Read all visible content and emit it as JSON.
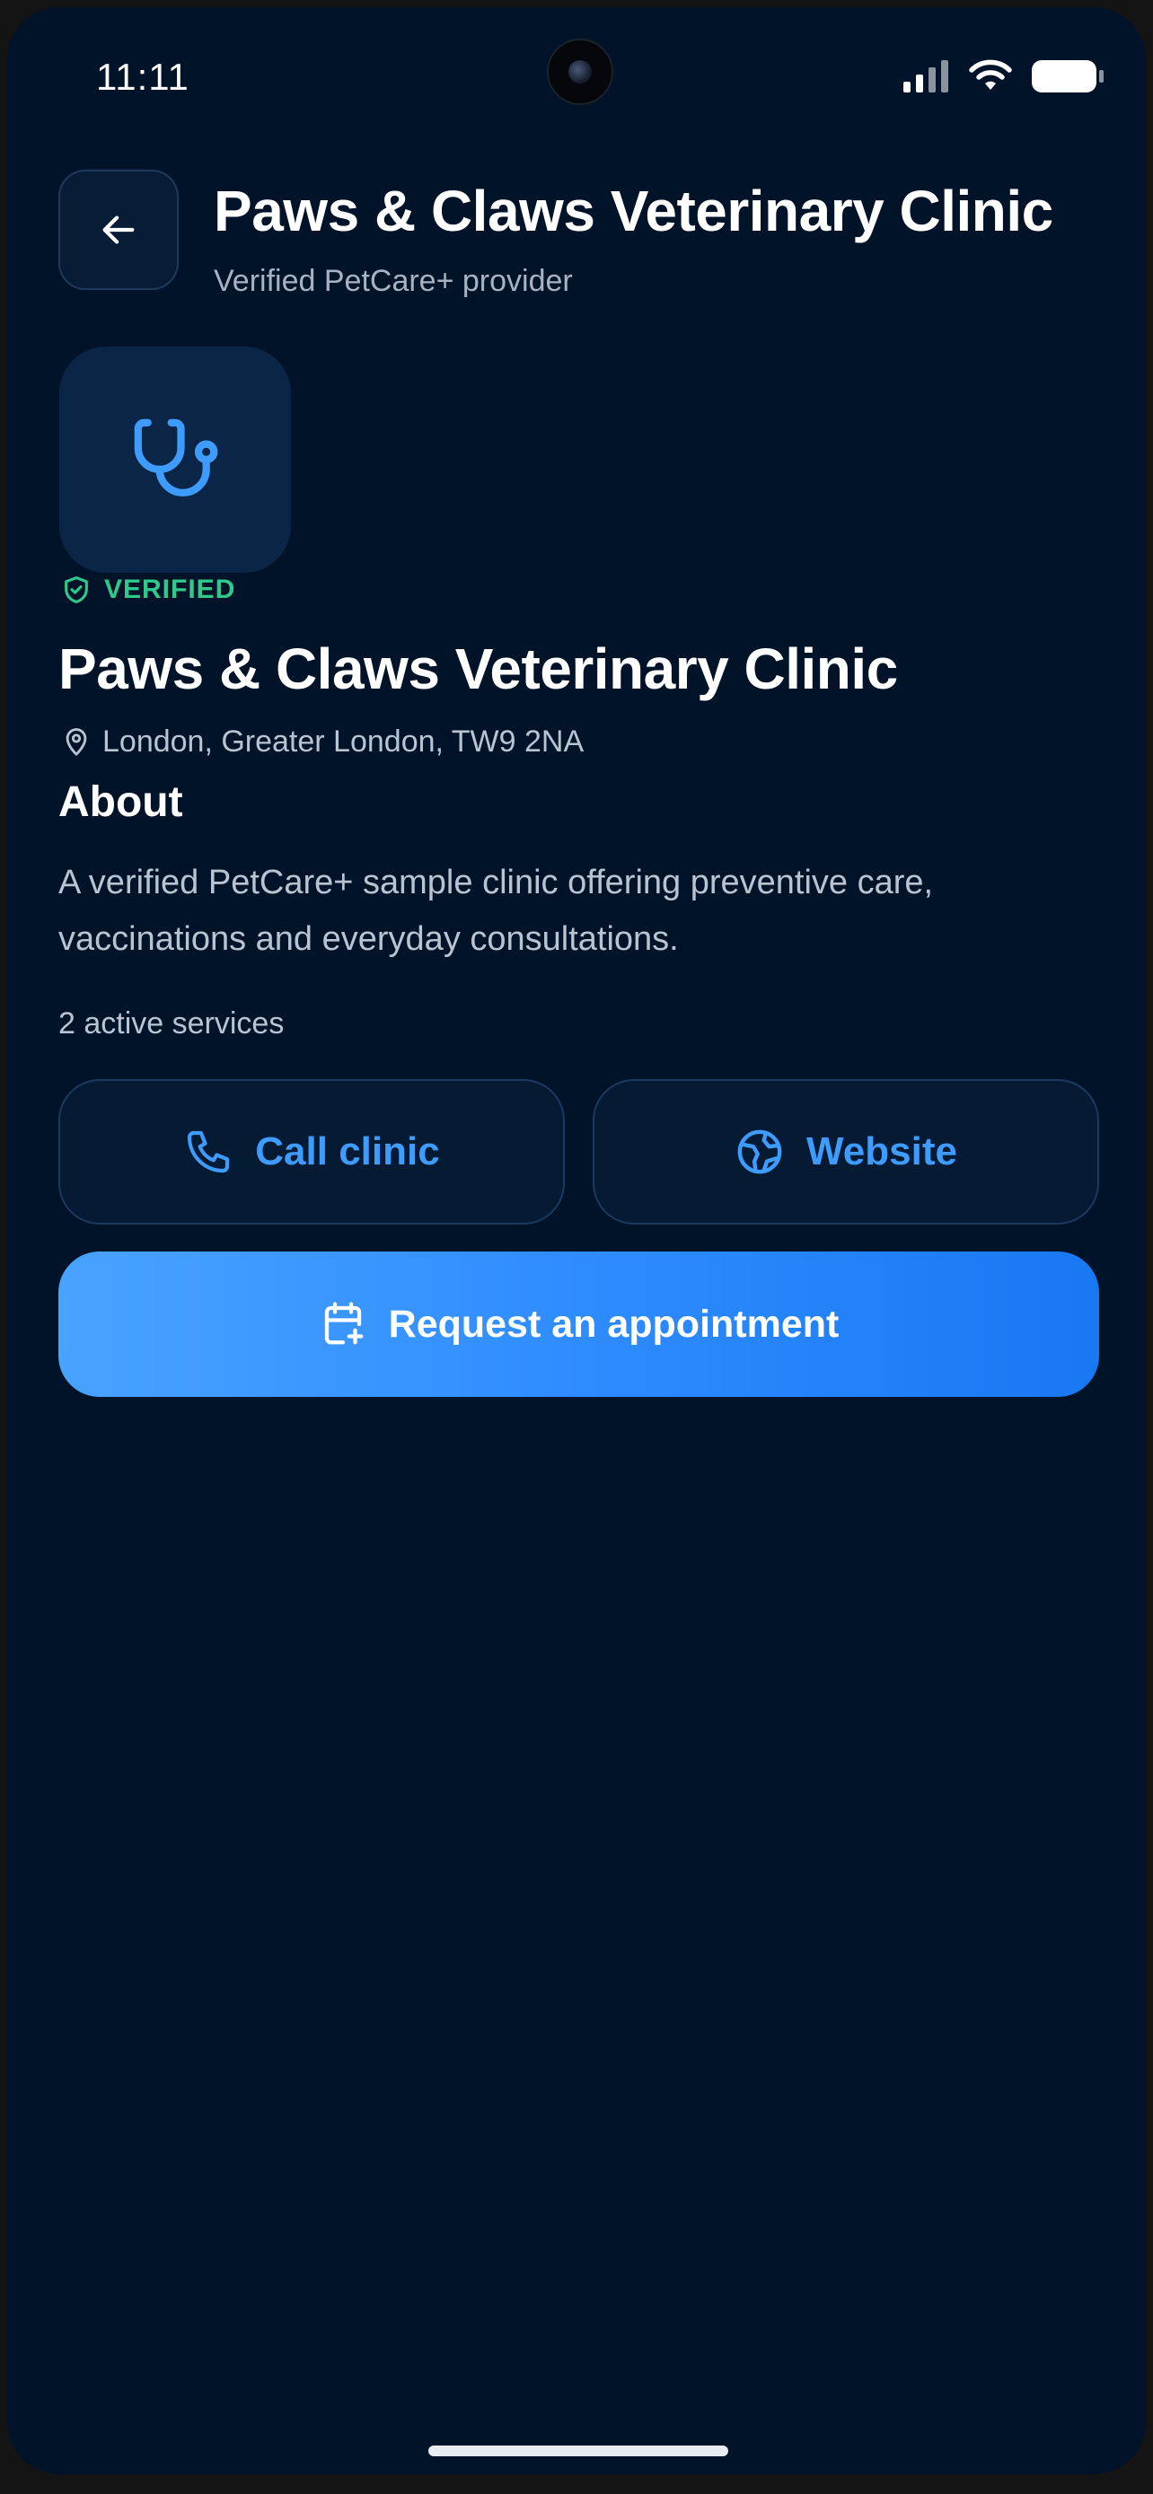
{
  "status_bar": {
    "time": "11:11"
  },
  "header": {
    "title": "Paws & Claws Veterinary Clinic",
    "subtitle": "Verified PetCare+ provider",
    "back_icon": "arrow-left-icon"
  },
  "clinic": {
    "icon": "stethoscope-icon",
    "badge": "VERIFIED",
    "name": "Paws & Claws Veterinary Clinic",
    "location": "London, Greater London, TW9 2NA"
  },
  "about": {
    "heading": "About",
    "text": "A verified PetCare+ sample clinic offering preventive care, vaccinations and everyday consultations."
  },
  "services": {
    "count_text": "2 active services"
  },
  "actions": {
    "call_label": "Call clinic",
    "website_label": "Website",
    "appointment_label": "Request an appointment"
  },
  "colors": {
    "background": "#011328",
    "accent": "#3e9bff",
    "verified": "#2fc98a",
    "primary_gradient_start": "#48a3ff",
    "primary_gradient_end": "#1878f2"
  }
}
